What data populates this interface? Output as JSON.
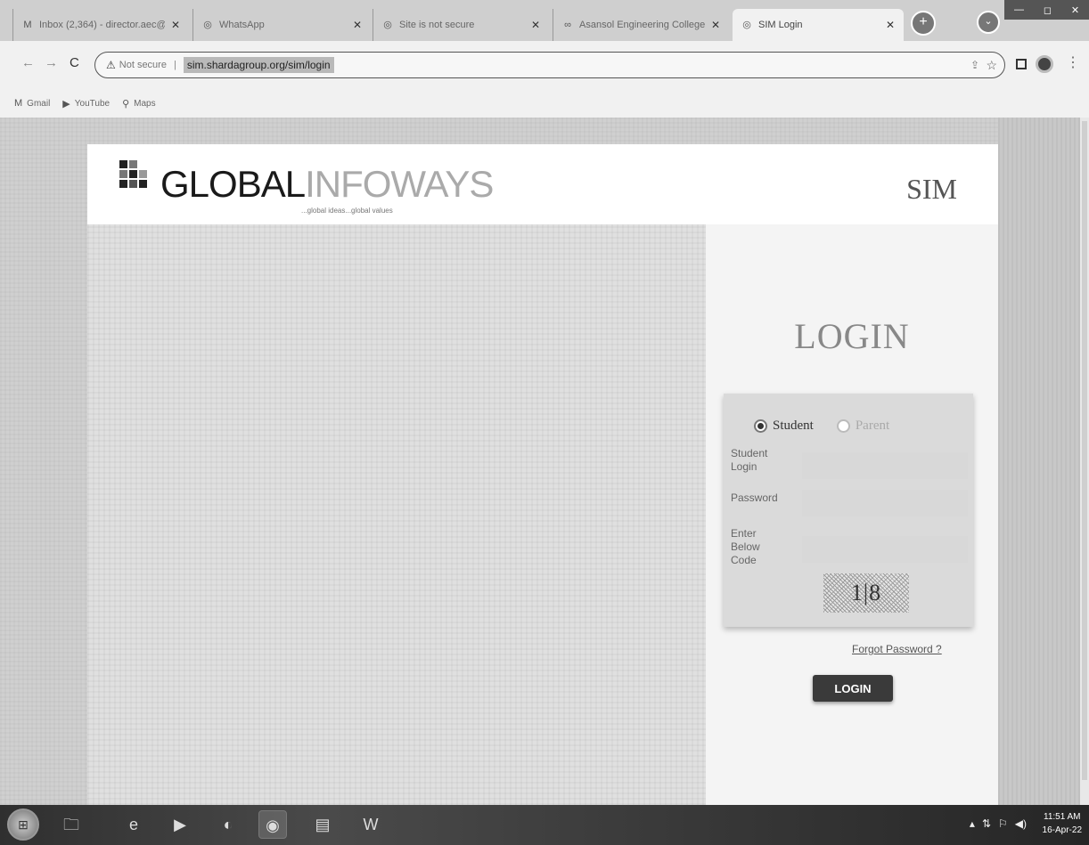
{
  "browser": {
    "tabs": [
      {
        "label": "Inbox (2,364) - director.aec@",
        "icon": "gmail-icon",
        "glyph": "M"
      },
      {
        "label": "WhatsApp",
        "icon": "whatsapp-icon",
        "glyph": "◎"
      },
      {
        "label": "Site is not secure",
        "icon": "globe-icon",
        "glyph": "◎"
      },
      {
        "label": "Asansol Engineering College i",
        "icon": "college-icon",
        "glyph": "∞"
      },
      {
        "label": "SIM Login",
        "icon": "globe-icon",
        "glyph": "◎"
      }
    ],
    "new_tab": "+",
    "tab_menu": "⌄",
    "window_controls": [
      "—",
      "◻",
      "✕"
    ],
    "nav": {
      "back": "←",
      "forward": "→",
      "reload": "C"
    },
    "security_label": "Not secure",
    "url": "sim.shardagroup.org/sim/login",
    "bookmarks": [
      {
        "label": "Gmail",
        "glyph": "M"
      },
      {
        "label": "YouTube",
        "glyph": "▶"
      },
      {
        "label": "Maps",
        "glyph": "⚲"
      }
    ]
  },
  "site": {
    "brand_bold": "GLOBAL",
    "brand_light": "INFOWAYS",
    "tagline": "...global ideas...global values",
    "product": "SIM"
  },
  "login": {
    "heading": "LOGIN",
    "role_student": "Student",
    "role_parent": "Parent",
    "student_login_label": "Student Login",
    "password_label": "Password",
    "code_label": "Enter Below Code",
    "captcha_text": "1|8",
    "forgot_link": "Forgot Password ?",
    "submit": "LOGIN"
  },
  "taskbar": {
    "start": "⊞",
    "apps": [
      {
        "name": "explorer-icon",
        "glyph": "🗀"
      },
      {
        "name": "ie-icon",
        "glyph": "e"
      },
      {
        "name": "media-player-icon",
        "glyph": "▶"
      },
      {
        "name": "firefox-icon",
        "glyph": "◐"
      },
      {
        "name": "chrome-icon",
        "glyph": "◉"
      },
      {
        "name": "notepad-icon",
        "glyph": "▤"
      },
      {
        "name": "word-icon",
        "glyph": "W"
      }
    ],
    "tray": {
      "up": "▴",
      "network": "⇅",
      "flag": "⚐",
      "volume": "◀)"
    },
    "time": "11:51 AM",
    "date": "16-Apr-22"
  }
}
